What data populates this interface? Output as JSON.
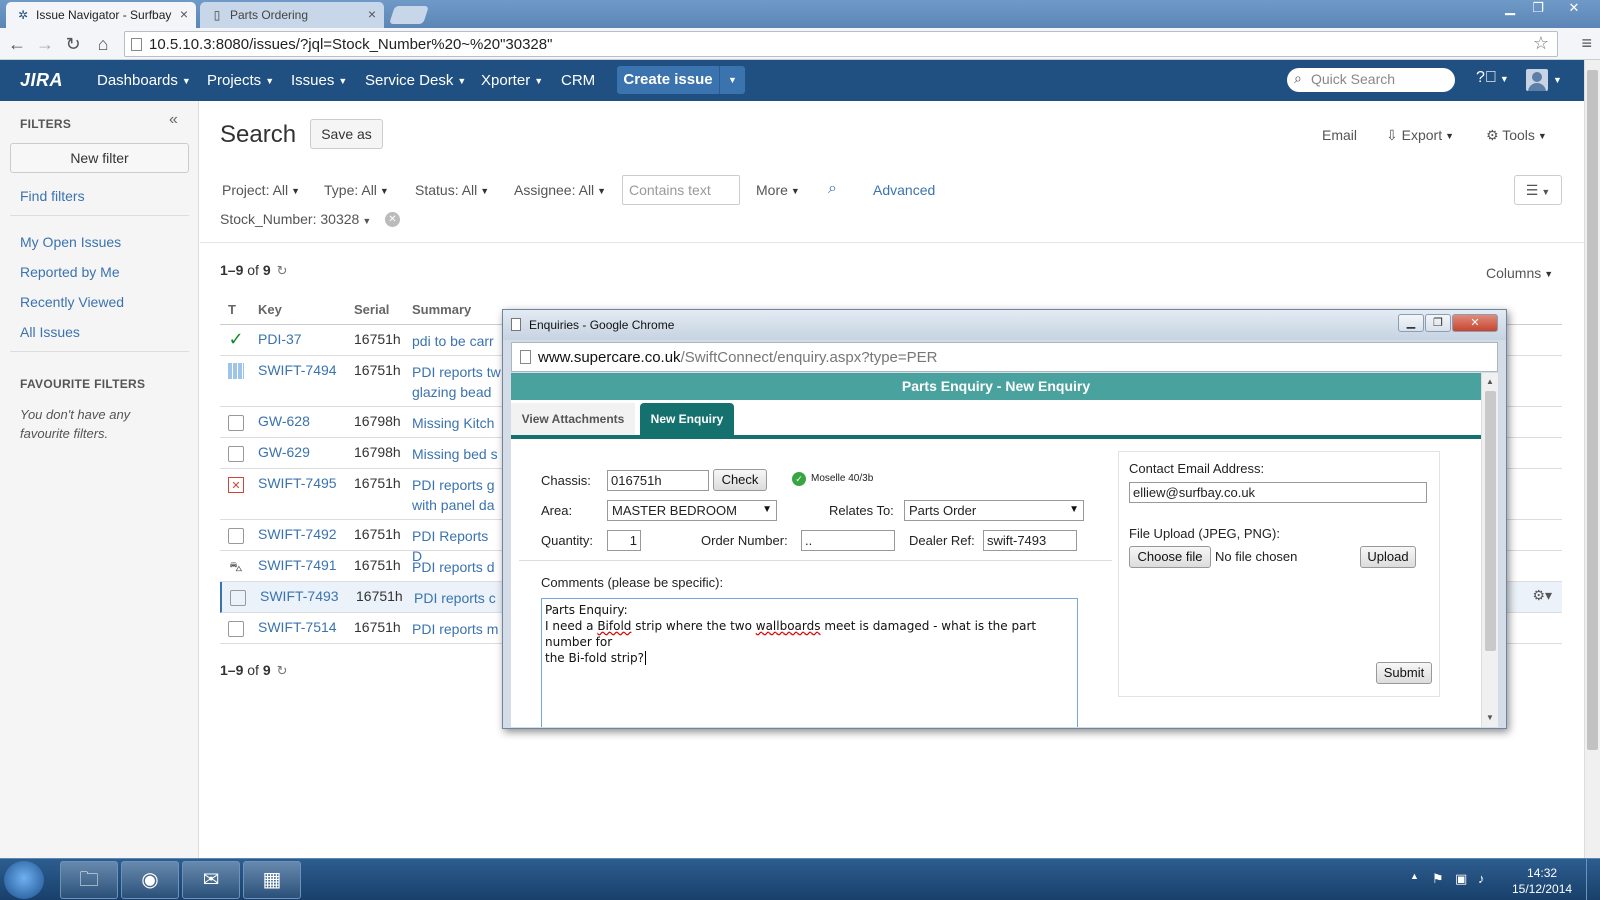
{
  "browser": {
    "tabs": [
      {
        "title": "Issue Navigator - Surfbay"
      },
      {
        "title": "Parts Ordering"
      }
    ],
    "url": "10.5.10.3:8080/issues/?jql=Stock_Number%20~%20\"30328\""
  },
  "jira": {
    "logo": "JIRA",
    "nav": [
      "Dashboards",
      "Projects",
      "Issues",
      "Service Desk",
      "Xporter",
      "CRM"
    ],
    "create_label": "Create issue",
    "quick_search_placeholder": "Quick Search"
  },
  "sidebar": {
    "filters_heading": "FILTERS",
    "new_filter": "New filter",
    "find_filters": "Find filters",
    "links": [
      "My Open Issues",
      "Reported by Me",
      "Recently Viewed",
      "All Issues"
    ],
    "favourite_heading": "FAVOURITE FILTERS",
    "favourite_note": "You don't have any favourite filters."
  },
  "search": {
    "title": "Search",
    "save_as": "Save as",
    "email": "Email",
    "export": "Export",
    "tools": "Tools",
    "criteria": {
      "project": "Project: All",
      "type": "Type: All",
      "status": "Status: All",
      "assignee": "Assignee: All",
      "contains_placeholder": "Contains text",
      "more": "More",
      "advanced": "Advanced",
      "stock_number": "Stock_Number: 30328"
    },
    "pager_range": "1–9",
    "pager_of": "of",
    "pager_total": "9",
    "columns": "Columns"
  },
  "table": {
    "headers": {
      "type": "T",
      "key": "Key",
      "serial": "Serial",
      "summary": "Summary"
    },
    "rows": [
      {
        "key": "PDI-37",
        "serial": "16751h",
        "summary": "pdi to be carr",
        "icon": "check-icon"
      },
      {
        "key": "SWIFT-7494",
        "serial": "16751h",
        "summary": "PDI reports tw glazing bead",
        "icon": "grid-icon"
      },
      {
        "key": "GW-628",
        "serial": "16798h",
        "summary": "Missing Kitch",
        "icon": "checkbox-icon"
      },
      {
        "key": "GW-629",
        "serial": "16798h",
        "summary": "Missing bed s",
        "icon": "checkbox-icon"
      },
      {
        "key": "SWIFT-7495",
        "serial": "16751h",
        "summary": "PDI reports g with panel da",
        "icon": "error-icon"
      },
      {
        "key": "SWIFT-7492",
        "serial": "16751h",
        "summary": "PDI Reports D",
        "icon": "checkbox-icon"
      },
      {
        "key": "SWIFT-7491",
        "serial": "16751h",
        "summary": "PDI reports d",
        "icon": "car-icon"
      },
      {
        "key": "SWIFT-7493",
        "serial": "16751h",
        "summary": "PDI reports c",
        "icon": "checkbox-icon"
      },
      {
        "key": "SWIFT-7514",
        "serial": "16751h",
        "summary": "PDI reports m",
        "icon": "checkbox-icon"
      }
    ]
  },
  "popup": {
    "title": "Enquiries - Google Chrome",
    "url_host": "www.supercare.co.uk",
    "url_path": "/SwiftConnect/enquiry.aspx?type=PER",
    "header": "Parts Enquiry - New Enquiry",
    "tabs": [
      "View Attachments",
      "New Enquiry"
    ],
    "form": {
      "chassis_label": "Chassis:",
      "chassis_value": "016751h",
      "check_label": "Check",
      "model": "Moselle 40/3b",
      "area_label": "Area:",
      "area_value": "MASTER BEDROOM",
      "relates_label": "Relates To:",
      "relates_value": "Parts Order",
      "quantity_label": "Quantity:",
      "quantity_value": "1",
      "order_label": "Order Number:",
      "order_value": "..",
      "dealer_label": "Dealer Ref:",
      "dealer_value": "swift-7493",
      "comments_label": "Comments (please be specific):",
      "comments_line1": "Parts Enquiry:",
      "comments_line2a": "I need a ",
      "comments_spell1": "Bifold",
      "comments_line2b": " strip where the two ",
      "comments_spell2": "wallboards",
      "comments_line2c": " meet is damaged - what is the part number for",
      "comments_line3": "the Bi-fold strip?",
      "email_label": "Contact Email Address:",
      "email_value": "elliew@surfbay.co.uk",
      "upload_label": "File Upload (JPEG, PNG):",
      "choose_file": "Choose file",
      "no_file": "No file chosen",
      "upload_btn": "Upload",
      "submit_btn": "Submit"
    }
  },
  "taskbar": {
    "time": "14:32",
    "date": "15/12/2014"
  },
  "colors": {
    "jira_header": "#205081",
    "link": "#3b73af",
    "enquiry_teal": "#4aa29f",
    "enquiry_tab_active": "#15716e"
  }
}
